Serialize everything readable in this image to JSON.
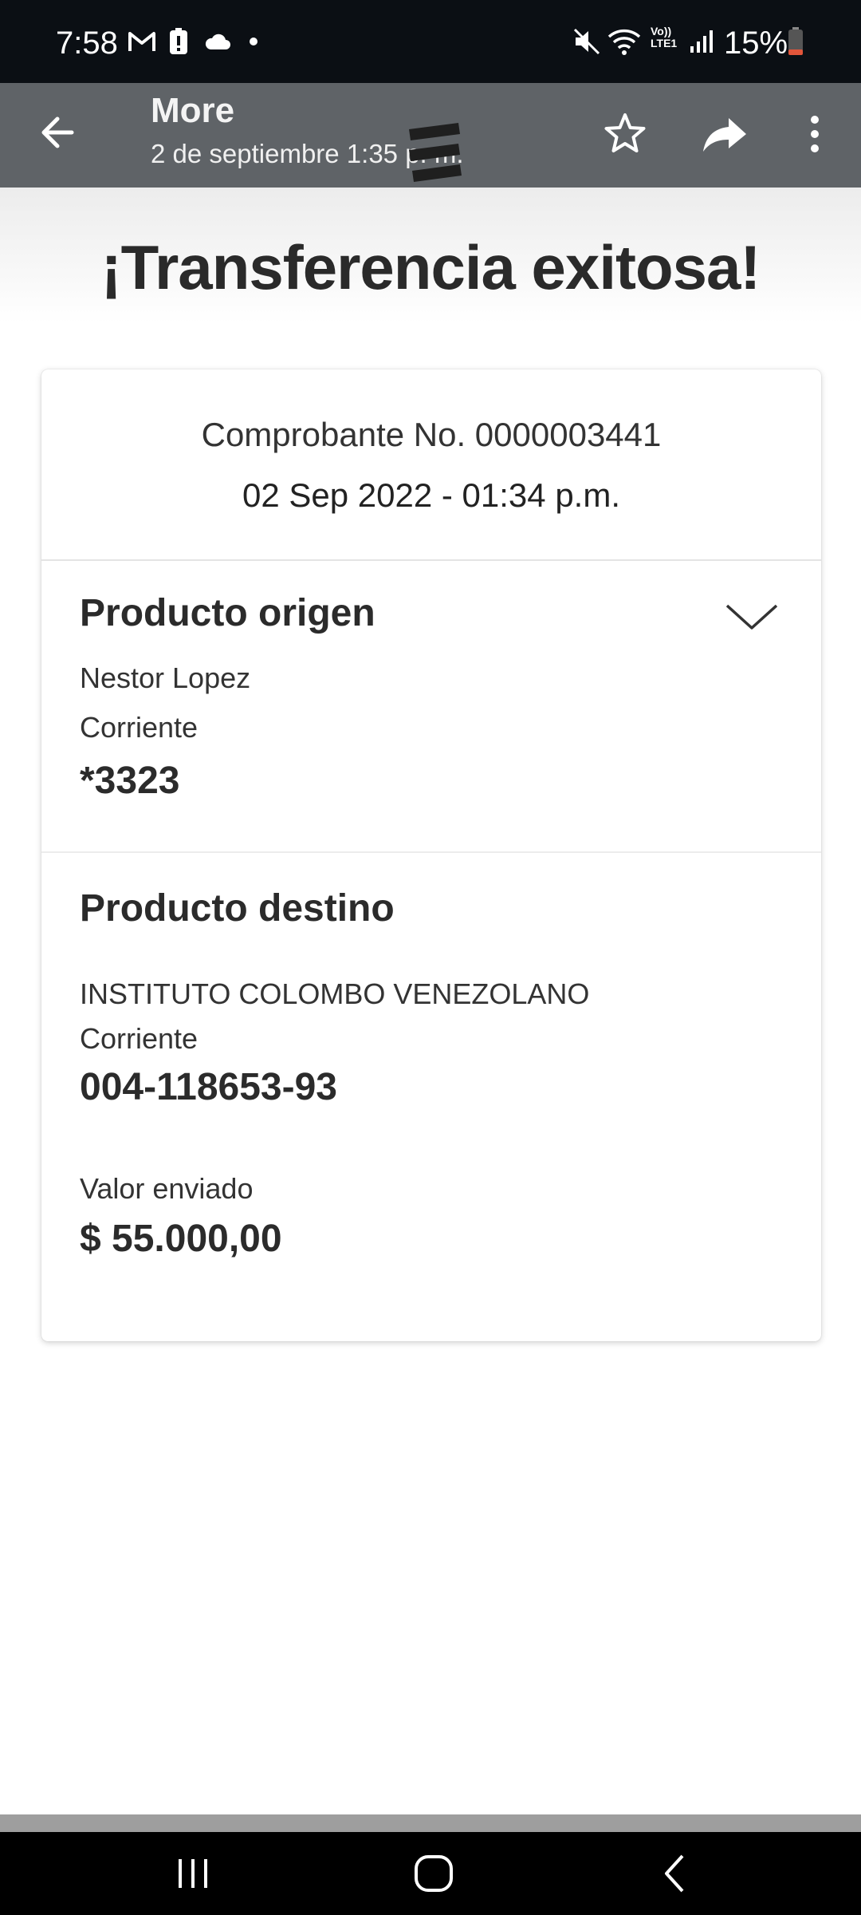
{
  "status_bar": {
    "time": "7:58",
    "battery_percent": "15%",
    "icons": [
      "gmail-icon",
      "alert-icon",
      "cloud-icon",
      "dot-icon",
      "mute-icon",
      "wifi-icon",
      "volte-icon",
      "signal-icon",
      "battery-icon"
    ],
    "volte_label": "Vo)) LTE1"
  },
  "app_bar": {
    "title": "More",
    "subtitle": "2 de septiembre 1:35 p. m."
  },
  "content": {
    "headline": "¡Transferencia exitosa!",
    "voucher": "Comprobante No. 0000003441",
    "datetime": "02 Sep 2022 - 01:34 p.m.",
    "origin": {
      "title": "Producto origen",
      "name": "Nestor Lopez",
      "account_type": "Corriente",
      "account_number": "*3323"
    },
    "destination": {
      "title": "Producto destino",
      "name": "INSTITUTO COLOMBO VENEZOLANO",
      "account_type": "Corriente",
      "account_number": "004-118653-93",
      "amount_label": "Valor enviado",
      "amount": "$ 55.000,00"
    }
  },
  "colors": {
    "status_bar_bg": "#0b0f14",
    "app_bar_bg": "#5f6367",
    "battery_low": "#e2553a"
  }
}
